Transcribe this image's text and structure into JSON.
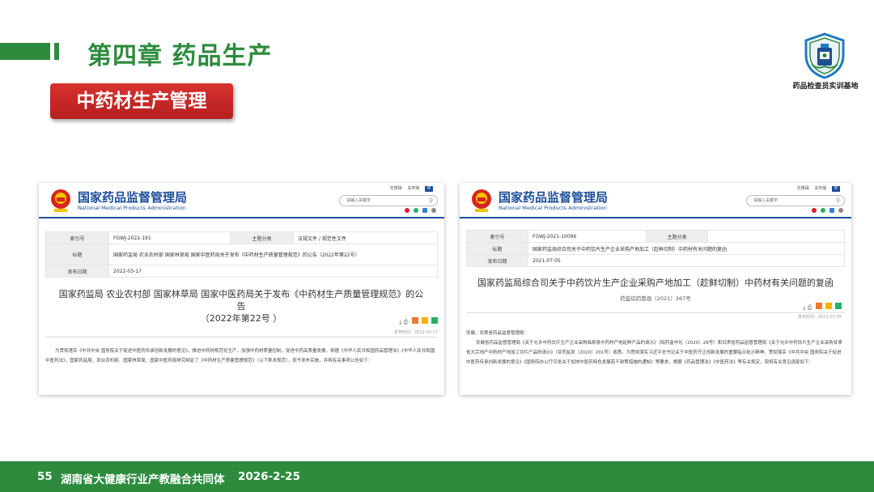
{
  "header": {
    "chapter_title": "第四章  药品生产",
    "section_tag": "中药材生产管理",
    "logo_caption": "药品检查员实训基地"
  },
  "site": {
    "name_cn": "国家药品监督管理局",
    "name_en": "National Medical Products Administration",
    "search_placeholder": "请输入关键字",
    "link_barrier_free": "无障碍",
    "link_care": "关怀版",
    "link_box": "中"
  },
  "doc_left": {
    "index_label": "索引号",
    "index_value": "FGWJ-2022-191",
    "category_label": "主题分类",
    "category_value": "法规文件 / 规范性文件",
    "title_label": "标题",
    "title_value": "国家药监局 农业农村部 国家林草局 国家中医药局关于发布《中药材生产质量管理规范》的公告（2022年第22号）",
    "date_label": "发布日期",
    "date_value": "2022-03-17",
    "heading_line1": "国家药监局 农业农村部 国家林草局 国家中医药局关于发布《中药材生产质量管理规范》的公告",
    "heading_line2": "（2022年第22号 ）",
    "pubtime": "发布时间：2022-03-17",
    "body": "为贯彻落实《中共中央 国务院关于促进中医药传承创新发展的意见》，推进中药材规范化生产，加强中药材质量控制，促进中药高质量发展，依据《中华人民共和国药品管理法》《中华人民共和国中医药法》，国家药监局、农业农村部、国家林草局、国家中医药局研究制定了《中药材生产质量管理规范》（以下称本规范），现予发布实施，并将有关事项公告如下："
  },
  "doc_right": {
    "index_label": "索引号",
    "index_value": "FGWJ-2021-10096",
    "category_label": "主题分类",
    "category_value": "",
    "title_label": "标题",
    "title_value": "国家药监局综合司关于中药饮片生产企业采购产地加工（趁鲜切制）中药材有关问题的复函",
    "date_label": "发布日期",
    "date_value": "2021-07-05",
    "heading": "国家药监局综合司关于中药饮片生产企业采购产地加工（趁鲜切制）中药材有关问题的复函",
    "doc_number": "药监综药管函〔2021〕367号",
    "pubtime": "发布时间：2021-07-05",
    "salutation": "安徽、甘肃省药品监督管理局：",
    "body": "安徽省药品监督管理局《关于允许中药饮片生产企业采购临泉县中药材产地趁鲜产品的请示》（皖药监中化〔2020〕28号）和甘肃省药品监督管理局《关于允许中药饮片生产企业采购甘肃省大宗地产中药材产地加工切片产品的请示》（甘药监发〔2020〕201号）收悉。为贯彻落实习近平总书记关于中医药守正创新发展的重要指示批示精神，贯彻落实《中共中央 国务院关于促进中医药传承创新发展的意见》《国务院办公厅印发关于加快中医药特色发展若干政策措施的通知》等要求，根据《药品管理法》《中医药法》等有关规定，现将有关意见函复如下："
  },
  "footer": {
    "page_number": "55",
    "org_name": "湖南省大健康行业产教融合共同体",
    "date": "2026-2-25"
  },
  "colors": {
    "brand_green": "#2e8b3e",
    "tag_red": "#c8282a",
    "site_blue": "#1e4e9a"
  }
}
